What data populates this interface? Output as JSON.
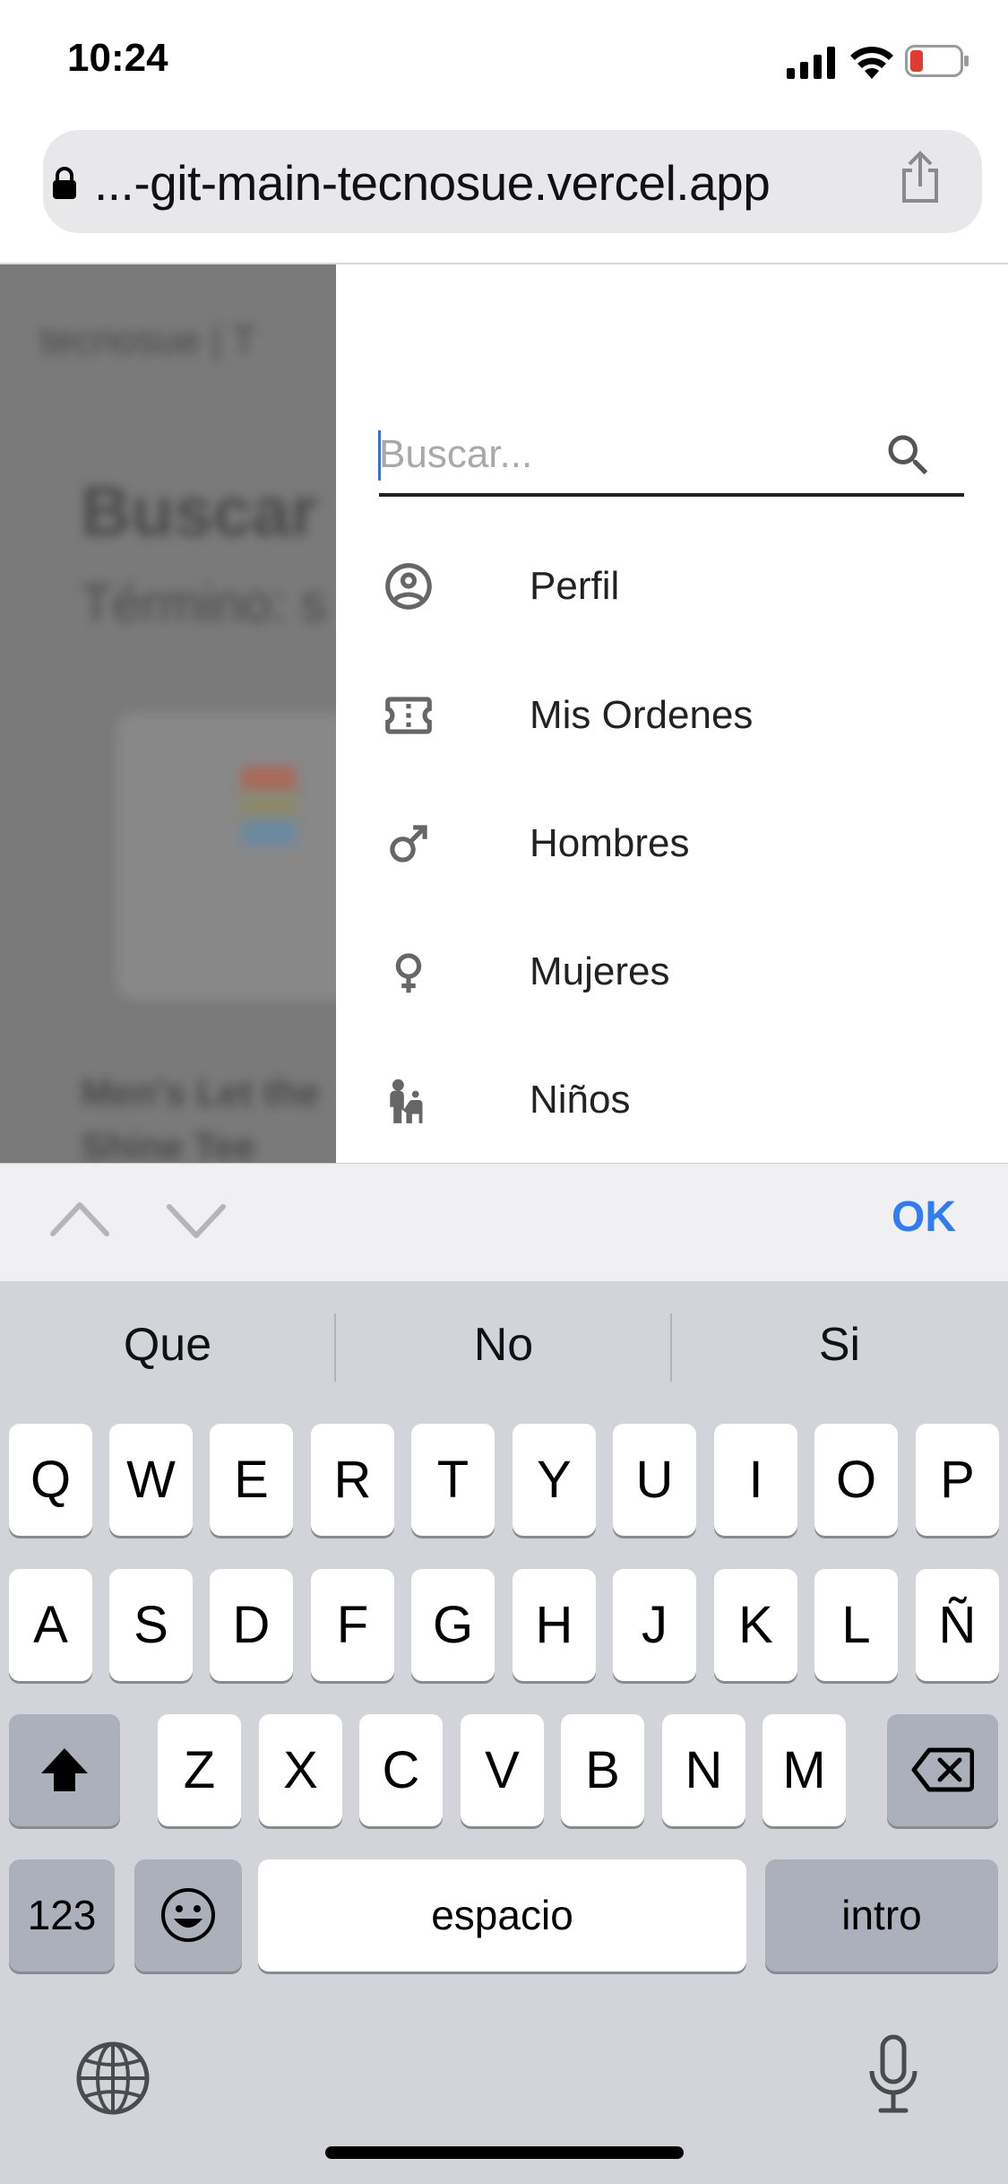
{
  "status_bar": {
    "time": "10:24"
  },
  "browser": {
    "url": "...-git-main-tecnosue.vercel.app"
  },
  "background_page": {
    "breadcrumb": "tecnosue | T",
    "heading": "Buscar",
    "subheading": "Término: s",
    "product_name_line1": "Men's Let the",
    "product_name_line2": "Shine Tee"
  },
  "drawer": {
    "search": {
      "placeholder": "Buscar..."
    },
    "items": [
      {
        "label": "Perfil",
        "icon": "account-circle-icon"
      },
      {
        "label": "Mis Ordenes",
        "icon": "ticket-icon"
      },
      {
        "label": "Hombres",
        "icon": "male-icon"
      },
      {
        "label": "Mujeres",
        "icon": "female-icon"
      },
      {
        "label": "Niños",
        "icon": "child-icon"
      }
    ]
  },
  "accessory_bar": {
    "ok": "OK"
  },
  "keyboard": {
    "suggestions": [
      "Que",
      "No",
      "Si"
    ],
    "row1": [
      "Q",
      "W",
      "E",
      "R",
      "T",
      "Y",
      "U",
      "I",
      "O",
      "P"
    ],
    "row2": [
      "A",
      "S",
      "D",
      "F",
      "G",
      "H",
      "J",
      "K",
      "L",
      "Ñ"
    ],
    "row3": [
      "Z",
      "X",
      "C",
      "V",
      "B",
      "N",
      "M"
    ],
    "numbers_key": "123",
    "space_key": "espacio",
    "return_key": "intro"
  },
  "colors": {
    "accent": "#2f7cf6",
    "drawer_bg": "#ffffff",
    "overlay": "#7a7a7a",
    "keyboard_bg": "#d2d4da"
  }
}
